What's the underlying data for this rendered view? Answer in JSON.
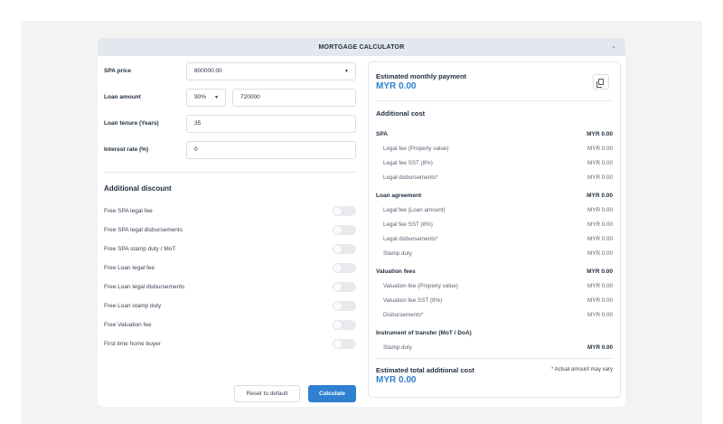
{
  "header": {
    "title": "MORTGAGE CALCULATOR"
  },
  "form": {
    "spa_price": {
      "label": "SPA price",
      "value": "800000.00"
    },
    "loan_amount": {
      "label": "Loan amount",
      "percent": "90%",
      "value": "720000"
    },
    "loan_tenure": {
      "label": "Loan tenure (Years)",
      "value": "35"
    },
    "interest_rate": {
      "label": "Interest rate (%)",
      "value": "0"
    }
  },
  "discount": {
    "title": "Additional discount",
    "items": [
      {
        "label": "Free SPA legal fee",
        "on": false
      },
      {
        "label": "Free SPA legal disbursements",
        "on": false
      },
      {
        "label": "Free SPA stamp duty / MoT",
        "on": false
      },
      {
        "label": "Free Loan legal fee",
        "on": false
      },
      {
        "label": "Free Loan legal disbursements",
        "on": false
      },
      {
        "label": "Free Loan stamp duty",
        "on": false
      },
      {
        "label": "Free Valuation fee",
        "on": false
      },
      {
        "label": "First time home buyer",
        "on": false
      }
    ]
  },
  "actions": {
    "reset_label": "Reset to default",
    "calculate_label": "Calculate"
  },
  "summary": {
    "monthly_title": "Estimated monthly payment",
    "monthly_amount": "MYR 0.00",
    "additional_title": "Additional cost",
    "groups": [
      {
        "name": "SPA",
        "total": "MYR 0.00",
        "lines": [
          {
            "label": "Legal fee (Property value)",
            "amount": "MYR 0.00"
          },
          {
            "label": "Legal fee SST (8%)",
            "amount": "MYR 0.00"
          },
          {
            "label": "Legal disbursements*",
            "amount": "MYR 0.00"
          }
        ]
      },
      {
        "name": "Loan agreement",
        "total": "MYR 0.00",
        "lines": [
          {
            "label": "Legal fee (Loan amount)",
            "amount": "MYR 0.00"
          },
          {
            "label": "Legal fee SST (8%)",
            "amount": "MYR 0.00"
          },
          {
            "label": "Legal disbursements*",
            "amount": "MYR 0.00"
          },
          {
            "label": "Stamp duty",
            "amount": "MYR 0.00"
          }
        ]
      },
      {
        "name": "Valuation fees",
        "total": "MYR 0.00",
        "lines": [
          {
            "label": "Valuation fee (Property value)",
            "amount": "MYR 0.00"
          },
          {
            "label": "Valuation fee SST (8%)",
            "amount": "MYR 0.00"
          },
          {
            "label": "Disbursements*",
            "amount": "MYR 0.00"
          }
        ]
      },
      {
        "name": "Instrument of transfer (MoT / DoA)",
        "total": "",
        "lines": [
          {
            "label": "Stamp duty",
            "amount": "MYR 0.00",
            "bold": true
          }
        ]
      }
    ],
    "total_title": "Estimated total additional cost",
    "total_note": "* Actual amount may vary",
    "total_amount": "MYR 0.00"
  },
  "colors": {
    "accent": "#2f80d1",
    "header_bg": "#e3e8ef",
    "page_bg": "#f3f3f4"
  }
}
